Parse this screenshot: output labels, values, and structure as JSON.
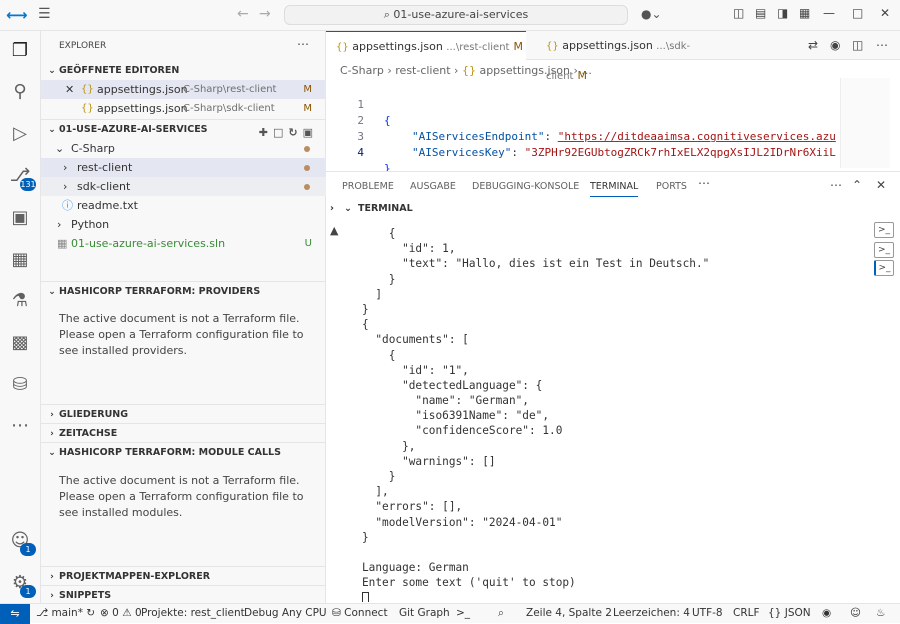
{
  "titlebar": {
    "search_text": "01-use-azure-ai-services",
    "search_icon": "search-icon",
    "copilot_icon": "copilot-icon"
  },
  "activity": {
    "scm_badge": "131",
    "accounts_badge": "1",
    "settings_badge": "1"
  },
  "sidebar": {
    "title": "EXPLORER",
    "open_editors": {
      "header": "GEÖFFNETE EDITOREN",
      "items": [
        {
          "name": "appsettings.json",
          "path": "C-Sharp\\rest-client",
          "status": "M"
        },
        {
          "name": "appsettings.json",
          "path": "C-Sharp\\sdk-client",
          "status": "M"
        }
      ]
    },
    "workspace": {
      "header": "01-USE-AZURE-AI-SERVICES",
      "items": [
        {
          "label": "C-Sharp"
        },
        {
          "label": "rest-client"
        },
        {
          "label": "sdk-client"
        },
        {
          "label": "readme.txt"
        },
        {
          "label": "Python"
        },
        {
          "label": "01-use-azure-ai-services.sln",
          "status": "U"
        }
      ]
    },
    "providers": {
      "header": "HASHICORP TERRAFORM: PROVIDERS",
      "message": "The active document is not a Terraform file. Please open a Terraform configuration file to see installed providers."
    },
    "outline_header": "GLIEDERUNG",
    "timeline_header": "ZEITACHSE",
    "module_calls": {
      "header": "HASHICORP TERRAFORM: MODULE CALLS",
      "message": "The active document is not a Terraform file. Please open a Terraform configuration file to see installed modules."
    },
    "solution_header": "PROJEKTMAPPEN-EXPLORER",
    "snippets_header": "SNIPPETS"
  },
  "editor": {
    "tabs": [
      {
        "name": "appsettings.json",
        "desc": "...\\rest-client",
        "status": "M"
      },
      {
        "name": "appsettings.json",
        "desc": "...\\sdk-client",
        "status": "M"
      }
    ],
    "breadcrumb": [
      "C-Sharp",
      "rest-client",
      "appsettings.json",
      "..."
    ],
    "lines": [
      {
        "n": "1",
        "text": "{"
      },
      {
        "n": "2",
        "key": "\"AIServicesEndpoint\"",
        "val": "\"https://ditdeaaimsa.cognitiveservices.azu"
      },
      {
        "n": "3",
        "key": "\"AIServicesKey\"",
        "val": "\"3ZPHr92EGUbtogZRCk7rhIxELX2qpgXsIJL2IDrNr6XiiL"
      },
      {
        "n": "4",
        "text": "}"
      }
    ]
  },
  "panel": {
    "tabs": [
      "PROBLEME",
      "AUSGABE",
      "DEBUGGING-KONSOLE",
      "TERMINAL",
      "PORTS"
    ],
    "active_tab": "TERMINAL",
    "terminal_header": "TERMINAL",
    "terminal_lines": [
      "    {",
      "      \"id\": 1,",
      "      \"text\": \"Hallo, dies ist ein Test in Deutsch.\"",
      "    }",
      "  ]",
      "}",
      "{",
      "  \"documents\": [",
      "    {",
      "      \"id\": \"1\",",
      "      \"detectedLanguage\": {",
      "        \"name\": \"German\",",
      "        \"iso6391Name\": \"de\",",
      "        \"confidenceScore\": 1.0",
      "      },",
      "      \"warnings\": []",
      "    }",
      "  ],",
      "  \"errors\": [],",
      "  \"modelVersion\": \"2024-04-01\"",
      "}",
      "",
      "Language: German",
      "Enter some text ('quit' to stop)"
    ]
  },
  "statusbar": {
    "branch": "main*",
    "errors": "0",
    "warnings": "0",
    "project": "Projekte: rest_client",
    "debug": "Debug Any CPU",
    "connect": "Connect",
    "gitgraph": "Git Graph",
    "position": "Zeile 4, Spalte 2",
    "spaces": "Leerzeichen: 4",
    "encoding": "UTF-8",
    "eol": "CRLF",
    "language": "JSON"
  },
  "colors": {
    "accent": "#005fb8",
    "modified": "#895503",
    "untracked": "#388a34"
  }
}
